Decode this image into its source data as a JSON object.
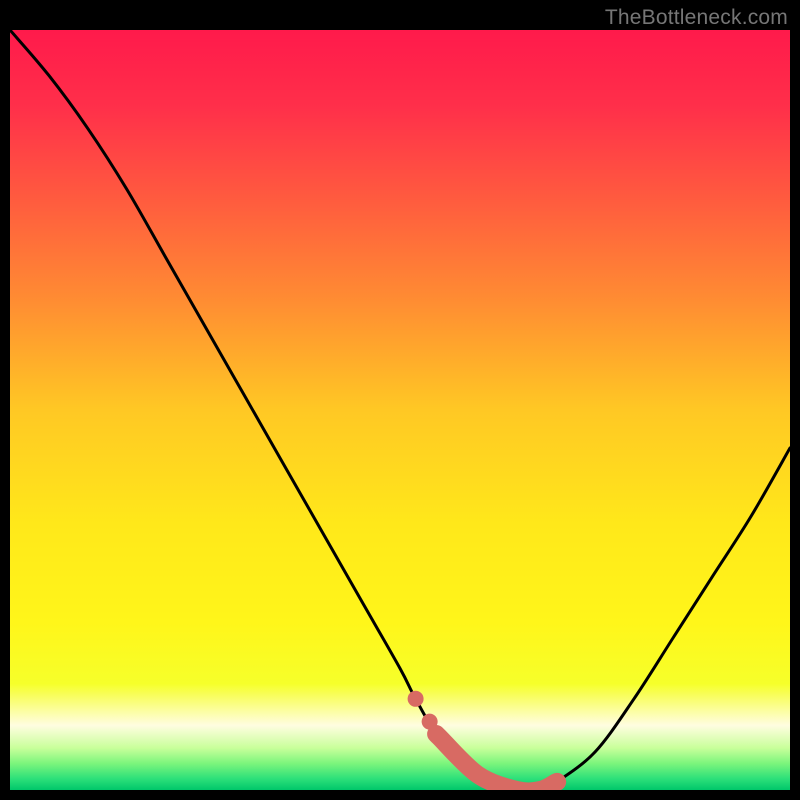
{
  "attribution": "TheBottleneck.com",
  "chart_data": {
    "type": "line",
    "title": "",
    "xlabel": "",
    "ylabel": "",
    "xlim": [
      0,
      100
    ],
    "ylim": [
      0,
      100
    ],
    "series": [
      {
        "name": "bottleneck-curve",
        "x": [
          0,
          5,
          10,
          15,
          20,
          25,
          30,
          35,
          40,
          45,
          50,
          52,
          55,
          60,
          65,
          68,
          70,
          75,
          80,
          85,
          90,
          95,
          100
        ],
        "values": [
          100,
          94,
          87,
          79,
          70,
          61,
          52,
          43,
          34,
          25,
          16,
          12,
          7,
          2,
          0,
          0,
          1,
          5,
          12,
          20,
          28,
          36,
          45
        ]
      }
    ],
    "optimal_band": {
      "x_start": 55,
      "x_end": 70
    },
    "gradient_stops": [
      {
        "offset": 0.0,
        "color": "#ff1a4b"
      },
      {
        "offset": 0.1,
        "color": "#ff2f4a"
      },
      {
        "offset": 0.22,
        "color": "#ff5a3f"
      },
      {
        "offset": 0.35,
        "color": "#ff8a33"
      },
      {
        "offset": 0.5,
        "color": "#ffc824"
      },
      {
        "offset": 0.65,
        "color": "#ffe81a"
      },
      {
        "offset": 0.78,
        "color": "#fff61a"
      },
      {
        "offset": 0.86,
        "color": "#f6ff2a"
      },
      {
        "offset": 0.915,
        "color": "#fffde0"
      },
      {
        "offset": 0.945,
        "color": "#c8ff9a"
      },
      {
        "offset": 0.965,
        "color": "#7cf57c"
      },
      {
        "offset": 0.985,
        "color": "#2de07a"
      },
      {
        "offset": 1.0,
        "color": "#00c76a"
      }
    ],
    "marker_color": "#d86a63",
    "curve_color": "#000000"
  }
}
